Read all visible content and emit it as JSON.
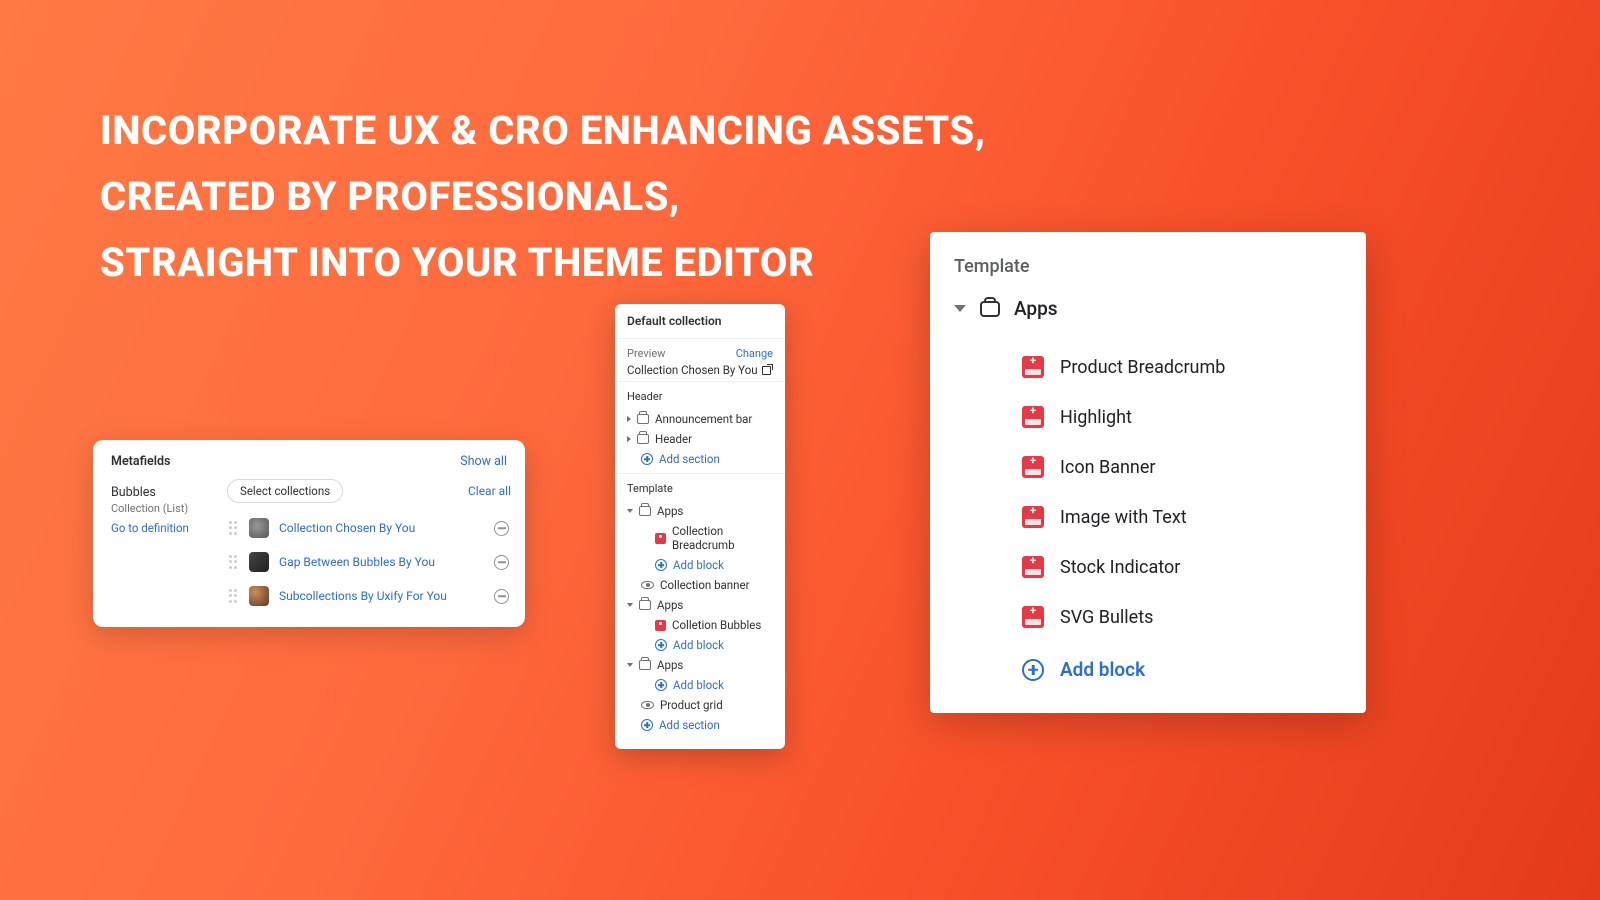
{
  "headline": {
    "line1": "INCORPORATE UX & CRO ENHANCING ASSETS,",
    "line2": "CREATED BY PROFESSIONALS,",
    "line3": "STRAIGHT INTO YOUR THEME EDITOR"
  },
  "panel1": {
    "title": "Metafields",
    "show_all": "Show all",
    "field_name": "Bubbles",
    "field_type": "Collection (List)",
    "definition_link": "Go to definition",
    "select_label": "Select collections",
    "clear_all": "Clear all",
    "items": [
      {
        "label": "Collection Chosen By You"
      },
      {
        "label": "Gap Between Bubbles By You"
      },
      {
        "label": "Subcollections By Uxify For You"
      }
    ]
  },
  "panel2": {
    "title": "Default collection",
    "preview_label": "Preview",
    "change": "Change",
    "preview_value": "Collection Chosen By You",
    "header_label": "Header",
    "announcement": "Announcement bar",
    "header_item": "Header",
    "add_section": "Add section",
    "template_label": "Template",
    "apps_label": "Apps",
    "collection_breadcrumb": "Collection Breadcrumb",
    "add_block": "Add block",
    "collection_banner": "Collection banner",
    "colletion_bubbles": "Colletion Bubbles",
    "product_grid": "Product grid"
  },
  "panel3": {
    "heading": "Template",
    "apps_label": "Apps",
    "items": [
      "Product Breadcrumb",
      "Highlight",
      "Icon Banner",
      "Image with Text",
      "Stock Indicator",
      "SVG Bullets"
    ],
    "add_block": "Add block"
  }
}
